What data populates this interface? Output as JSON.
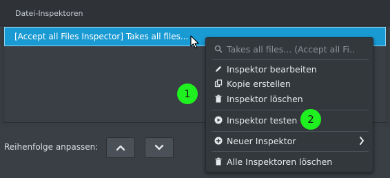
{
  "panel": {
    "title": "Datei-Inspektoren",
    "selected_row": "[Accept all Files Inspector] Takes all files..."
  },
  "bottom": {
    "sort_label": "Reihenfolge anpassen:",
    "up_icon": "chevron-up-icon",
    "down_icon": "chevron-down-icon"
  },
  "context_menu": {
    "header": "Takes all files... (Accept all Fi..",
    "edit": "Inspektor bearbeiten",
    "copy": "Kopie erstellen",
    "delete": "Inspektor löschen",
    "test": "Inspektor testen",
    "new": "Neuer Inspektor",
    "delete_all": "Alle Inspektoren löschen"
  },
  "annotations": {
    "badge_1": "1",
    "badge_2": "2",
    "badge_color": "#1ff01f"
  },
  "colors": {
    "selection": "#1a9ad3",
    "background": "#3a3f45",
    "menu_bg": "#33383d"
  }
}
